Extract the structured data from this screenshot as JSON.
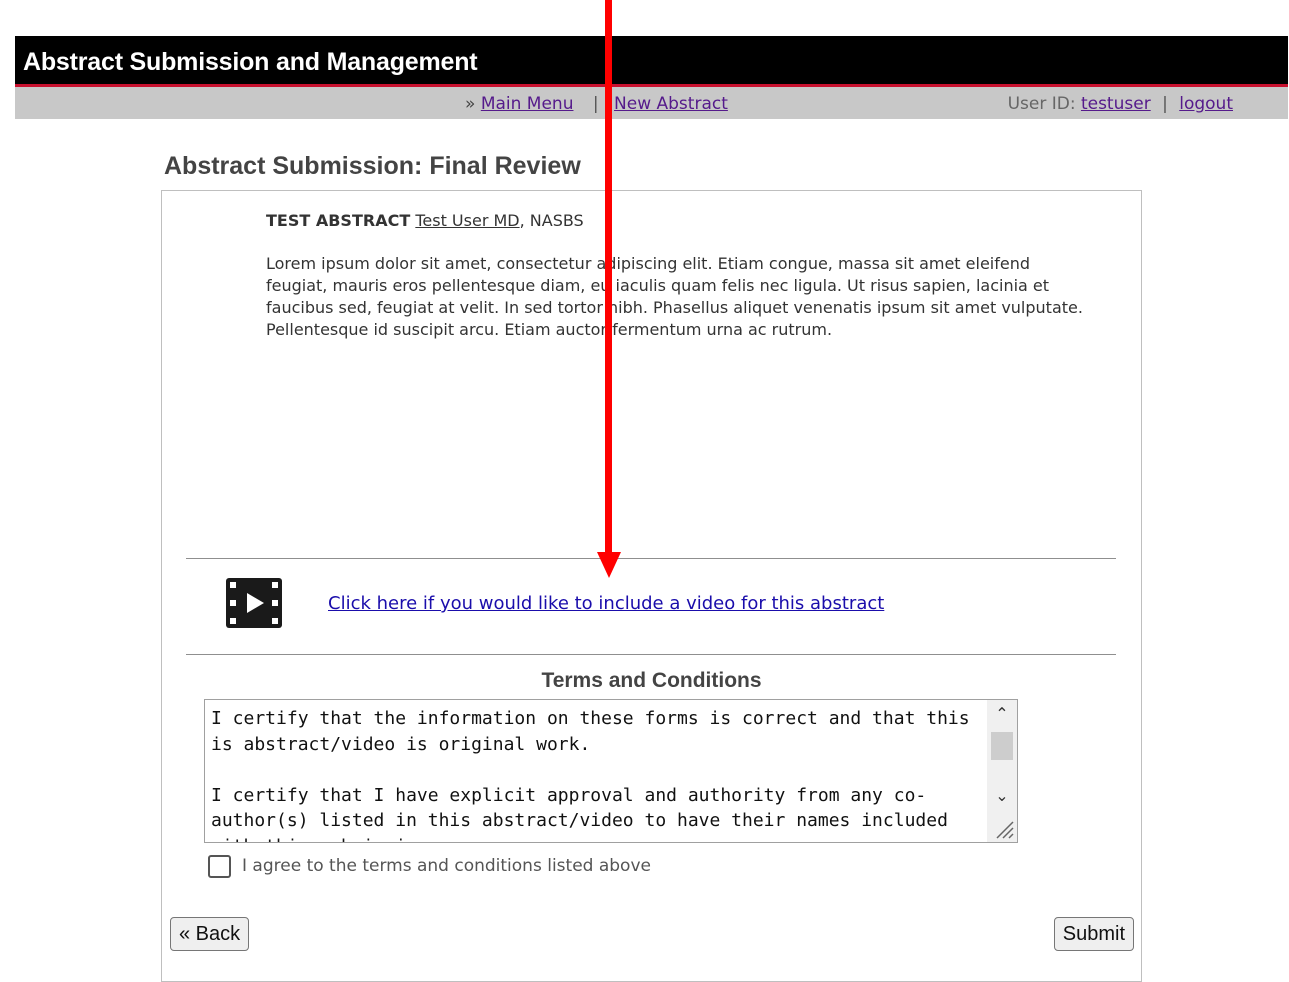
{
  "header": {
    "app_title": "Abstract Submission and Management"
  },
  "nav": {
    "prefix": "»",
    "main_menu": "Main Menu",
    "separator": "|",
    "new_abstract": "New Abstract",
    "user_id_label": "User ID:",
    "user_id": "testuser",
    "bar": "|",
    "logout": "logout"
  },
  "page": {
    "title": "Abstract Submission: Final Review"
  },
  "abstract": {
    "title": "TEST ABSTRACT",
    "author": "Test User MD",
    "affiliation": ", NASBS",
    "body": "Lorem ipsum dolor sit amet, consectetur adipiscing elit. Etiam congue, massa sit amet eleifend feugiat, mauris eros pellentesque diam, eu iaculis quam felis nec ligula. Ut risus sapien, lacinia et faucibus sed, feugiat at velit. In sed tortor nibh. Phasellus aliquet venenatis ipsum sit amet vulputate. Pellentesque id suscipit arcu. Etiam auctor fermentum urna ac rutrum."
  },
  "video": {
    "icon": "film-icon",
    "link_text": "Click here if you would like to include a video for this abstract"
  },
  "terms": {
    "heading": "Terms and Conditions",
    "text": "I certify that the information on these forms is correct and that this is abstract/video is original work.\n\nI certify that I have explicit approval and authority from any co-author(s) listed in this abstract/video to have their names included with this submission.",
    "agree_label": "I agree to the terms and conditions listed above",
    "agree_checked": false
  },
  "buttons": {
    "back": "« Back",
    "submit": "Submit"
  },
  "colors": {
    "accent_red": "#c8102e",
    "annotation_red": "#ff0000",
    "link_blue": "#1a0dab",
    "link_visited": "#551a8b"
  }
}
